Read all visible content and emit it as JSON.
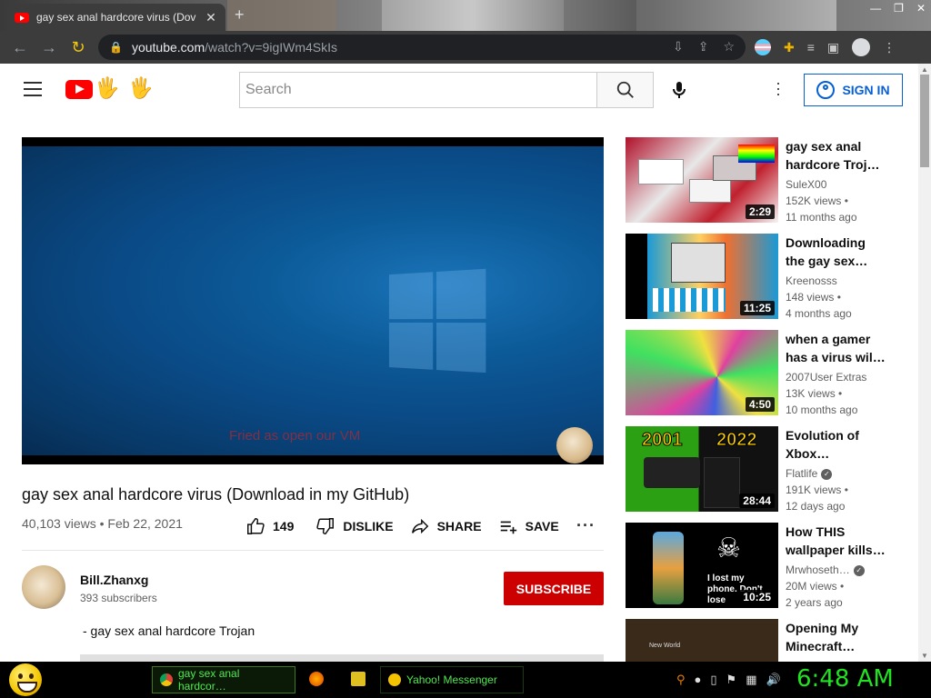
{
  "browser": {
    "tab_title": "gay sex anal hardcore virus (Dov",
    "url_host": "youtube.com",
    "url_path": "/watch?v=9igIWm4SkIs"
  },
  "youtube": {
    "search_placeholder": "Search",
    "sign_in": "SIGN IN",
    "video": {
      "caption": "Fried as open our VM",
      "title": "gay sex anal hardcore virus (Download in my GitHub)",
      "stats": "40,103 views • Feb 22, 2021",
      "likes": "149",
      "dislike": "DISLIKE",
      "share": "SHARE",
      "save": "SAVE"
    },
    "channel": {
      "name": "Bill.Zhanxg",
      "subscribers": "393 subscribers",
      "subscribe": "SUBSCRIBE"
    },
    "description": "- gay sex anal hardcore Trojan",
    "recommendations": [
      {
        "title": "gay sex anal hardcore Troj…",
        "channel": "SuleX00",
        "views": "152K views •",
        "age": "11 months ago",
        "duration": "2:29"
      },
      {
        "title": "Downloading the gay sex…",
        "channel": "Kreenosss",
        "views": "148 views •",
        "age": "4 months ago",
        "duration": "11:25"
      },
      {
        "title": "when a gamer has a virus wil…",
        "channel": "2007User Extras",
        "views": "13K views •",
        "age": "10 months ago",
        "duration": "4:50"
      },
      {
        "title": "Evolution of Xbox…",
        "channel": "Flatlife",
        "views": "191K views •",
        "age": "12 days ago",
        "duration": "28:44",
        "thumb_text_left": "2001",
        "thumb_text_right": "2022"
      },
      {
        "title": "How THIS wallpaper kills…",
        "channel": "Mrwhoseth…",
        "views": "20M views •",
        "age": "2 years ago",
        "duration": "10:25",
        "thumb_text": "I lost my phone. Don't lose"
      },
      {
        "title": "Opening My Minecraft…",
        "thumb_text": "New World"
      }
    ]
  },
  "taskbar": {
    "chrome_label": "gay sex anal hardcor…",
    "yahoo_label": "Yahoo! Messenger",
    "clock": "6:48 AM"
  }
}
